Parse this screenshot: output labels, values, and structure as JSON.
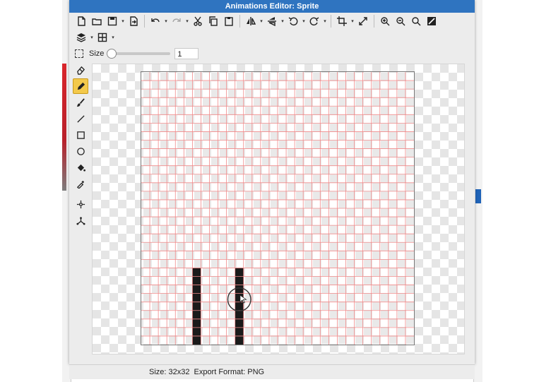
{
  "window": {
    "title": "Animations Editor: Sprite"
  },
  "toolbar": {
    "row1": [
      "new-file-icon",
      "open-folder-icon",
      "save-icon",
      "caret",
      "export-icon",
      "sep",
      "undo-icon",
      "caret",
      "redo-icon",
      "caret",
      "cut-icon",
      "copy-icon",
      "paste-icon",
      "sep",
      "flip-horizontal-icon",
      "caret",
      "flip-vertical-icon",
      "caret",
      "rotate-left-icon",
      "caret",
      "rotate-right-icon",
      "caret",
      "sep",
      "crop-icon",
      "caret",
      "resize-icon",
      "sep",
      "zoom-in-icon",
      "zoom-out-icon",
      "zoom-fit-icon",
      "actual-size-icon"
    ],
    "row2": [
      "layers-icon",
      "caret",
      "grid-icon",
      "caret"
    ]
  },
  "size_control": {
    "label": "Size",
    "value": "1",
    "slider_fraction": 0.0
  },
  "left_tools": [
    "eraser-icon",
    "pencil-icon",
    "brush-icon",
    "line-icon",
    "rectangle-icon",
    "ellipse-icon",
    "fill-bucket-icon",
    "eyedropper-icon",
    "gap",
    "move-point-icon",
    "transform-icon"
  ],
  "active_tool": "pencil-icon",
  "sprite": {
    "grid_size": 32,
    "filled_columns": [
      6,
      11
    ],
    "filled_rows_from": 23,
    "fill_color": "#1a1a1a",
    "grid_color": "#f08a8a"
  },
  "status": {
    "size": "Size: 32x32",
    "format": "Export Format: PNG"
  },
  "colors": {
    "titlebar": "#2f74c0",
    "active_tool": "#f3c94b"
  }
}
